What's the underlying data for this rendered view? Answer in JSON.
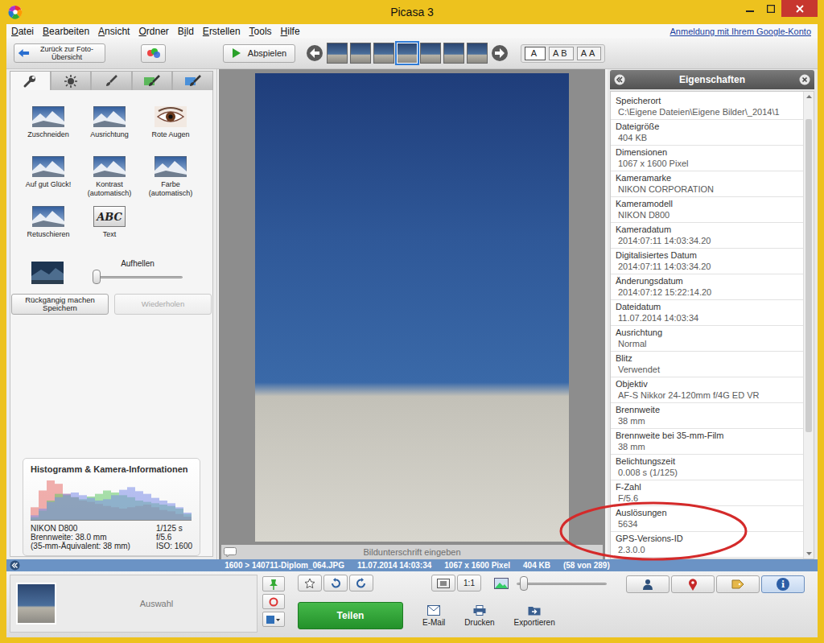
{
  "window": {
    "title": "Picasa 3"
  },
  "menu": [
    {
      "label": "Datei",
      "mnemonic": 0
    },
    {
      "label": "Bearbeiten",
      "mnemonic": 0
    },
    {
      "label": "Ansicht",
      "mnemonic": 0
    },
    {
      "label": "Ordner",
      "mnemonic": 0
    },
    {
      "label": "Bild",
      "mnemonic": 1
    },
    {
      "label": "Erstellen",
      "mnemonic": 0
    },
    {
      "label": "Tools",
      "mnemonic": 0
    },
    {
      "label": "Hilfe",
      "mnemonic": 0
    }
  ],
  "account_link": "Anmeldung mit Ihrem Google-Konto",
  "toolbar": {
    "back_button": "Zurück zur Foto-Übersicht",
    "play_button": "Abspielen",
    "thumbnails": [
      {
        "selected": false
      },
      {
        "selected": false
      },
      {
        "selected": false
      },
      {
        "selected": true
      },
      {
        "selected": false
      },
      {
        "selected": false
      },
      {
        "selected": false
      }
    ],
    "view_buttons": [
      {
        "label": "A",
        "selected": true
      },
      {
        "label": "AB",
        "selected": false
      },
      {
        "label": "AA",
        "selected": false
      }
    ]
  },
  "edit_tabs": [
    {
      "selected": true
    },
    {
      "selected": false
    },
    {
      "selected": false
    },
    {
      "selected": false
    },
    {
      "selected": false
    }
  ],
  "tools": [
    {
      "label": "Zuschneiden",
      "kind": "landscape"
    },
    {
      "label": "Ausrichtung",
      "kind": "landscape"
    },
    {
      "label": "Rote Augen",
      "kind": "eye"
    },
    {
      "label": "Auf gut Glück!",
      "kind": "landscape"
    },
    {
      "label": "Kontrast (automatisch)",
      "kind": "landscape"
    },
    {
      "label": "Farbe (automatisch)",
      "kind": "landscape"
    },
    {
      "label": "Retuschieren",
      "kind": "landscape"
    },
    {
      "label": "Text",
      "kind": "text",
      "icon_text": "ABC"
    }
  ],
  "brighten": {
    "label": "Aufhellen",
    "level": 0
  },
  "undo_button": {
    "lines": [
      "Rückgängig machen",
      "Speichern"
    ]
  },
  "redo_button": {
    "label": "Wiederholen",
    "disabled": true
  },
  "histogram": {
    "title": "Histogramm & Kamera-Informationen",
    "series": [
      {
        "color": "#e8706c",
        "values": [
          20,
          45,
          60,
          55,
          40,
          35,
          30,
          28,
          25,
          22,
          20,
          18,
          20,
          22,
          24,
          20,
          16,
          14,
          10,
          6
        ]
      },
      {
        "color": "#62c866",
        "values": [
          5,
          15,
          30,
          40,
          38,
          35,
          32,
          36,
          40,
          45,
          42,
          38,
          35,
          30,
          28,
          26,
          24,
          22,
          18,
          10
        ]
      },
      {
        "color": "#7c8ce8",
        "values": [
          8,
          18,
          28,
          35,
          40,
          42,
          38,
          34,
          30,
          32,
          38,
          46,
          50,
          44,
          40,
          34,
          30,
          26,
          20,
          12
        ]
      }
    ],
    "info_left": [
      "NIKON D800",
      "Brennweite: 38.0 mm",
      "(35-mm-Äquivalent: 38 mm)"
    ],
    "info_right": [
      "1/125 s",
      "f/5.6",
      "ISO: 1600"
    ]
  },
  "caption": {
    "placeholder": "Bildunterschrift eingeben"
  },
  "properties": {
    "title": "Eigenschaften",
    "rows": [
      {
        "label": "Speicherort",
        "value": "C:\\Eigene Dateien\\Eigene Bilder\\_2014\\1",
        "highlighted": false
      },
      {
        "label": "Dateigröße",
        "value": "404 KB",
        "highlighted": false
      },
      {
        "label": "Dimensionen",
        "value": "1067 x 1600 Pixel",
        "highlighted": false
      },
      {
        "label": "Kameramarke",
        "value": "NIKON CORPORATION",
        "highlighted": false
      },
      {
        "label": "Kameramodell",
        "value": "NIKON D800",
        "highlighted": false
      },
      {
        "label": "Kameradatum",
        "value": "2014:07:11 14:03:34.20",
        "highlighted": false
      },
      {
        "label": "Digitalisiertes Datum",
        "value": "2014:07:11 14:03:34.20",
        "highlighted": false
      },
      {
        "label": "Änderungsdatum",
        "value": "2014:07:12 15:22:14.20",
        "highlighted": false
      },
      {
        "label": "Dateidatum",
        "value": "11.07.2014 14:03:34",
        "highlighted": false
      },
      {
        "label": "Ausrichtung",
        "value": "Normal",
        "highlighted": false
      },
      {
        "label": "Blitz",
        "value": "Verwendet",
        "highlighted": false
      },
      {
        "label": "Objektiv",
        "value": "AF-S Nikkor 24-120mm f/4G ED VR",
        "highlighted": false
      },
      {
        "label": "Brennweite",
        "value": "38 mm",
        "highlighted": false
      },
      {
        "label": "Brennweite bei 35-mm-Film",
        "value": "38 mm",
        "highlighted": false
      },
      {
        "label": "Belichtungszeit",
        "value": "0.008 s (1/125)",
        "highlighted": false
      },
      {
        "label": "F-Zahl",
        "value": "F/5.6",
        "highlighted": false
      },
      {
        "label": "Auslösungen",
        "value": "5634",
        "highlighted": true
      },
      {
        "label": "GPS-Versions-ID",
        "value": "2.3.0.0",
        "highlighted": true
      }
    ],
    "scrollbar": {
      "position": 0.04,
      "level": 0.7
    }
  },
  "status_bar": {
    "segments": [
      "1600 > 140711-Diplom_064.JPG",
      "11.07.2014 14:03:34",
      "1067 x 1600 Pixel",
      "404 KB",
      "(58 von 289)"
    ]
  },
  "tray": {
    "selection_label": "Auswahl",
    "actual_size_button": "1:1",
    "zoom": {
      "level": 0.04
    },
    "share_button": "Teilen",
    "actions": [
      {
        "label": "E-Mail"
      },
      {
        "label": "Drucken"
      },
      {
        "label": "Exportieren"
      }
    ],
    "panel_buttons": [
      {
        "selected": false,
        "glyph": ""
      },
      {
        "selected": false,
        "glyph": ""
      },
      {
        "selected": false,
        "glyph": ""
      },
      {
        "selected": true,
        "glyph": "i"
      }
    ]
  }
}
